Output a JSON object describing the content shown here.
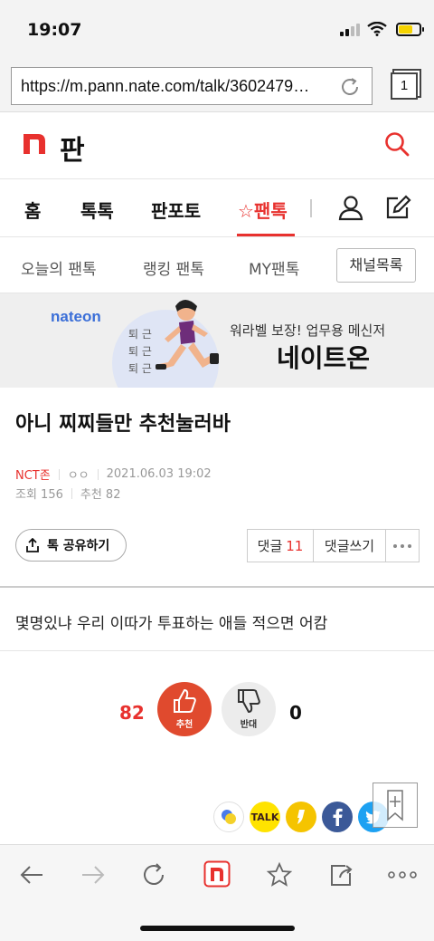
{
  "status": {
    "time": "19:07"
  },
  "browser": {
    "url": "https://m.pann.nate.com/talk/3602479…",
    "tab_count": "1"
  },
  "site": {
    "logo_text": "판"
  },
  "nav": {
    "items": [
      {
        "label": "홈"
      },
      {
        "label": "톡톡"
      },
      {
        "label": "판포토"
      },
      {
        "label": "☆팬톡"
      }
    ]
  },
  "subnav": {
    "items": [
      {
        "label": "오늘의 팬톡"
      },
      {
        "label": "랭킹 팬톡"
      },
      {
        "label": "MY팬톡"
      }
    ],
    "channel_button": "채널목록"
  },
  "banner": {
    "brand": "nateon",
    "side_text_1": "퇴 근",
    "side_text_2": "퇴 근",
    "side_text_3": "퇴 근",
    "subtitle": "워라벨 보장! 업무용 메신저",
    "title": "네이트온"
  },
  "article": {
    "title": "아니 찌찌들만 추천눌러바",
    "category": "NCT존",
    "author": "ㅇㅇ",
    "date": "2021.06.03 19:02",
    "views": "조회 156",
    "recommends": "추천 82",
    "share_label": "톡 공유하기",
    "comment_label": "댓글",
    "comment_count": "11",
    "write_comment_label": "댓글쓰기",
    "body": "몇명있냐 우리 이따가 투표하는 애들 적으면 어캄"
  },
  "votes": {
    "up_count": "82",
    "up_label": "추천",
    "down_label": "반대",
    "down_count": "0"
  },
  "social": {
    "kakaotalk_label": "TALK"
  },
  "colors": {
    "accent": "#e8312e",
    "vote_up": "#e04a2e",
    "facebook": "#3b5998",
    "twitter": "#1da1f2",
    "kakao": "#ffe300"
  }
}
